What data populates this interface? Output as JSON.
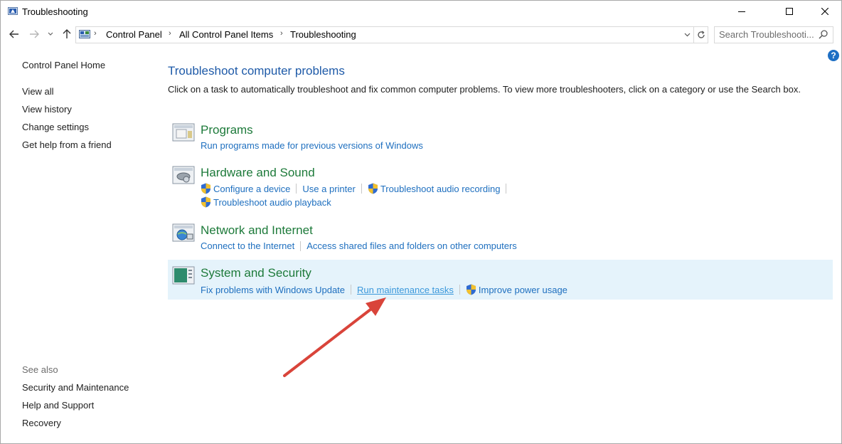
{
  "window": {
    "title": "Troubleshooting"
  },
  "address": {
    "crumbs": [
      "Control Panel",
      "All Control Panel Items",
      "Troubleshooting"
    ],
    "search_placeholder": "Search Troubleshooti..."
  },
  "help": {
    "label": "?"
  },
  "sidebar": {
    "home": "Control Panel Home",
    "items": [
      "View all",
      "View history",
      "Change settings",
      "Get help from a friend"
    ],
    "see_also_title": "See also",
    "see_also": [
      "Security and Maintenance",
      "Help and Support",
      "Recovery"
    ]
  },
  "main": {
    "title": "Troubleshoot computer problems",
    "description": "Click on a task to automatically troubleshoot and fix common computer problems. To view more troubleshooters, click on a category or use the Search box.",
    "categories": [
      {
        "title": "Programs",
        "links": [
          "Run programs made for previous versions of Windows"
        ]
      },
      {
        "title": "Hardware and Sound",
        "links": [
          "Configure a device",
          "Use a printer",
          "Troubleshoot audio recording",
          "Troubleshoot audio playback"
        ]
      },
      {
        "title": "Network and Internet",
        "links": [
          "Connect to the Internet",
          "Access shared files and folders on other computers"
        ]
      },
      {
        "title": "System and Security",
        "links": [
          "Fix problems with Windows Update",
          "Run maintenance tasks",
          "Improve power usage"
        ]
      }
    ]
  },
  "colors": {
    "link": "#1e6fbf",
    "category_title": "#1d7a3a",
    "page_title": "#1e5aa8",
    "highlight": "#e5f3fb",
    "annotation_arrow": "#d9443a"
  }
}
